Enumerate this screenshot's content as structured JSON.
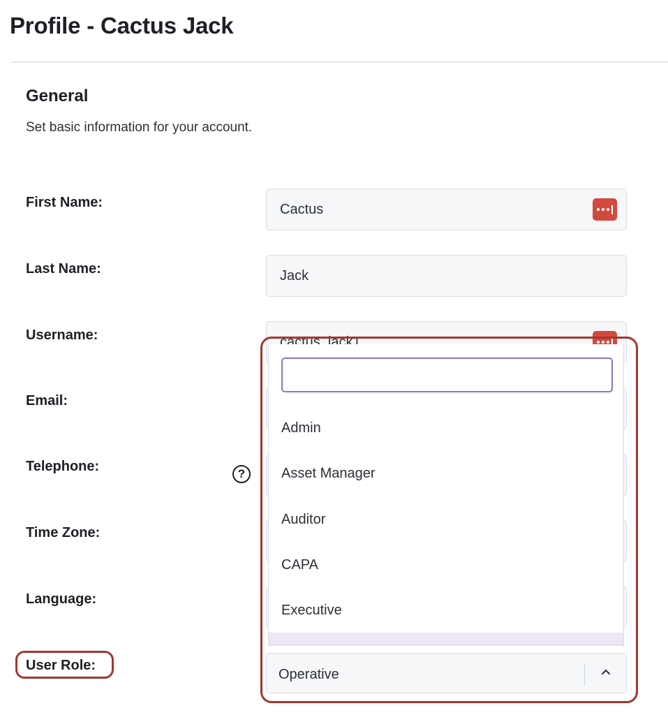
{
  "page": {
    "title": "Profile - Cactus Jack"
  },
  "general": {
    "heading": "General",
    "description": "Set basic information for your account."
  },
  "fields": {
    "first_name": {
      "label": "First Name:",
      "value": "Cactus"
    },
    "last_name": {
      "label": "Last Name:",
      "value": "Jack"
    },
    "username": {
      "label": "Username:",
      "value": "cactus_jack1"
    },
    "email": {
      "label": "Email:"
    },
    "telephone": {
      "label": "Telephone:"
    },
    "time_zone": {
      "label": "Time Zone:"
    },
    "language": {
      "label": "Language:"
    },
    "user_role": {
      "label": "User Role:",
      "value": "Operative"
    }
  },
  "role_dropdown": {
    "search_value": "",
    "options": [
      "Admin",
      "Asset Manager",
      "Auditor",
      "CAPA",
      "Executive"
    ]
  },
  "icons": {
    "password_manager": "password-manager-icon",
    "help": "help-icon",
    "chevron": "chevron-up-icon"
  },
  "help_glyph": "?",
  "colors": {
    "accent": "#8d76b8",
    "annotation": "#a4362e",
    "password_manager": "#d24a3e"
  }
}
